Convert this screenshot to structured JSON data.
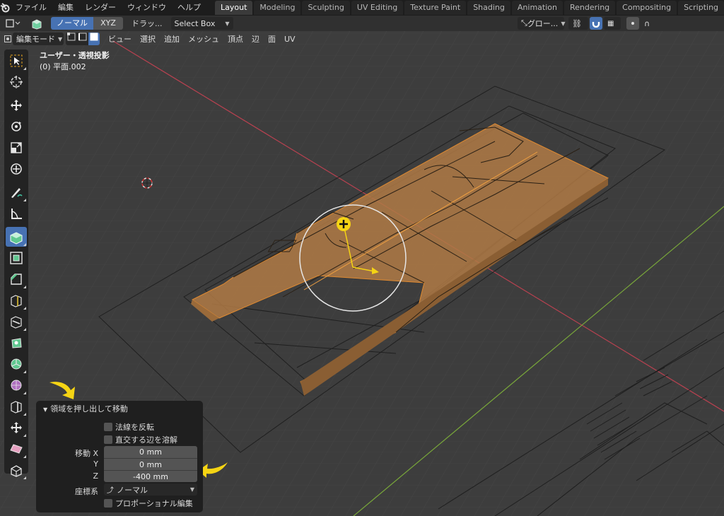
{
  "topbar": {
    "menus": [
      "ファイル",
      "編集",
      "レンダー",
      "ウィンドウ",
      "ヘルプ"
    ],
    "workspaces": [
      "Layout",
      "Modeling",
      "Sculpting",
      "UV Editing",
      "Texture Paint",
      "Shading",
      "Animation",
      "Rendering",
      "Compositing",
      "Scripting"
    ],
    "active_workspace": "Layout",
    "add_label": "+"
  },
  "header1": {
    "orientation_active": "ノーマル",
    "orientation_xyz": "XYZ",
    "drag_label": "ドラッ...",
    "select_box": "Select Box",
    "transform_orientation": "グロー..."
  },
  "header2": {
    "mode": "編集モード",
    "menus": [
      "ビュー",
      "選択",
      "追加",
      "メッシュ",
      "頂点",
      "辺",
      "面",
      "UV"
    ]
  },
  "viewport": {
    "view_name": "ユーザー・透視投影",
    "object_name": "(0) 平面.002"
  },
  "toolbar": {
    "tools": [
      "select-box",
      "cursor",
      "move",
      "rotate",
      "scale",
      "transform",
      "annotate",
      "measure",
      "extrude-region",
      "inset-faces",
      "bevel",
      "loop-cut",
      "knife",
      "poly-build",
      "spin",
      "smooth",
      "edge-slide",
      "shrink-fatten",
      "shear",
      "rip-region"
    ],
    "active_tool": "extrude-region"
  },
  "redo_panel": {
    "title": "領域を押し出して移動",
    "flip_normals": "法線を反転",
    "dissolve_orthogonal": "直交する辺を溶解",
    "move_label": "移動 X",
    "y_label": "Y",
    "z_label": "Z",
    "move_x": "0 mm",
    "move_y": "0 mm",
    "move_z": "-400 mm",
    "orientation_label": "座標系",
    "orientation_value": "ノーマル",
    "proportional": "プロポーショナル編集"
  },
  "colors": {
    "accent": "#4772b3",
    "face_selected": "#b07a45",
    "annotation_yellow": "#f5d414",
    "x_axis": "#c0404e",
    "y_axis": "#7fae3c"
  }
}
